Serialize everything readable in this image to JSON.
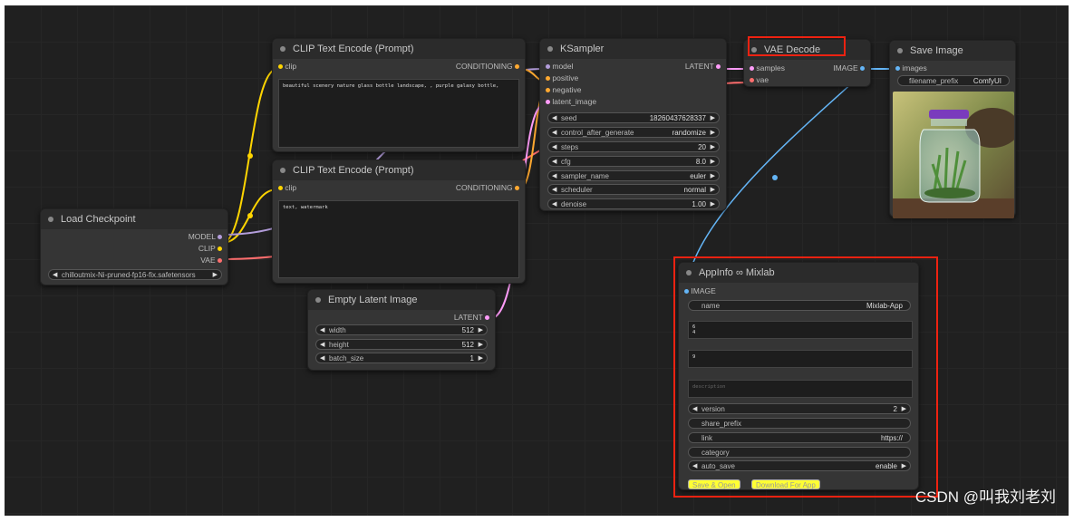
{
  "colors": {
    "clip": "#ffd500",
    "model": "#b39ddb",
    "vae": "#ff6e6e",
    "latent": "#ff9cf9",
    "image": "#64b5f6",
    "conditioning": "#ffa931",
    "highlight": "#e21f1f"
  },
  "nodes": {
    "clip_pos": {
      "title": "CLIP Text Encode (Prompt)",
      "in_clip": "clip",
      "out": "CONDITIONING",
      "text": "beautiful scenery nature glass bottle landscape, , purple galaxy bottle,"
    },
    "clip_neg": {
      "title": "CLIP Text Encode (Prompt)",
      "in_clip": "clip",
      "out": "CONDITIONING",
      "text": "text, watermark"
    },
    "checkpoint": {
      "title": "Load Checkpoint",
      "out_model": "MODEL",
      "out_clip": "CLIP",
      "out_vae": "VAE",
      "ckpt_value": "chilloutmix-Ni-pruned-fp16-fix.safetensors"
    },
    "latent": {
      "title": "Empty Latent Image",
      "out": "LATENT",
      "widgets": [
        {
          "label": "width",
          "value": "512"
        },
        {
          "label": "height",
          "value": "512"
        },
        {
          "label": "batch_size",
          "value": "1"
        }
      ]
    },
    "ksampler": {
      "title": "KSampler",
      "out": "LATENT",
      "inputs": [
        "model",
        "positive",
        "negative",
        "latent_image"
      ],
      "widgets": [
        {
          "label": "seed",
          "value": "18260437628337"
        },
        {
          "label": "control_after_generate",
          "value": "randomize"
        },
        {
          "label": "steps",
          "value": "20"
        },
        {
          "label": "cfg",
          "value": "8.0"
        },
        {
          "label": "sampler_name",
          "value": "euler"
        },
        {
          "label": "scheduler",
          "value": "normal"
        },
        {
          "label": "denoise",
          "value": "1.00"
        }
      ]
    },
    "vae_decode": {
      "title": "VAE Decode",
      "in_samples": "samples",
      "in_vae": "vae",
      "out": "IMAGE"
    },
    "save_image": {
      "title": "Save Image",
      "in_images": "images",
      "prefix_label": "filename_prefix",
      "prefix_value": "ComfyUI"
    },
    "appinfo": {
      "title": "AppInfo ∞ Mixlab",
      "in_image": "IMAGE",
      "name_label": "name",
      "name_value": "Mixlab-App",
      "text1": "6\n4",
      "text2": "9",
      "desc_placeholder": "description",
      "version_label": "version",
      "version_value": "2",
      "share_label": "share_prefix",
      "link_label": "link",
      "link_value": "https://",
      "category_label": "category",
      "autosave_label": "auto_save",
      "autosave_value": "enable",
      "btn_save": "Save & Open",
      "btn_download": "Download For App"
    }
  },
  "watermark": "CSDN @叫我刘老刘"
}
